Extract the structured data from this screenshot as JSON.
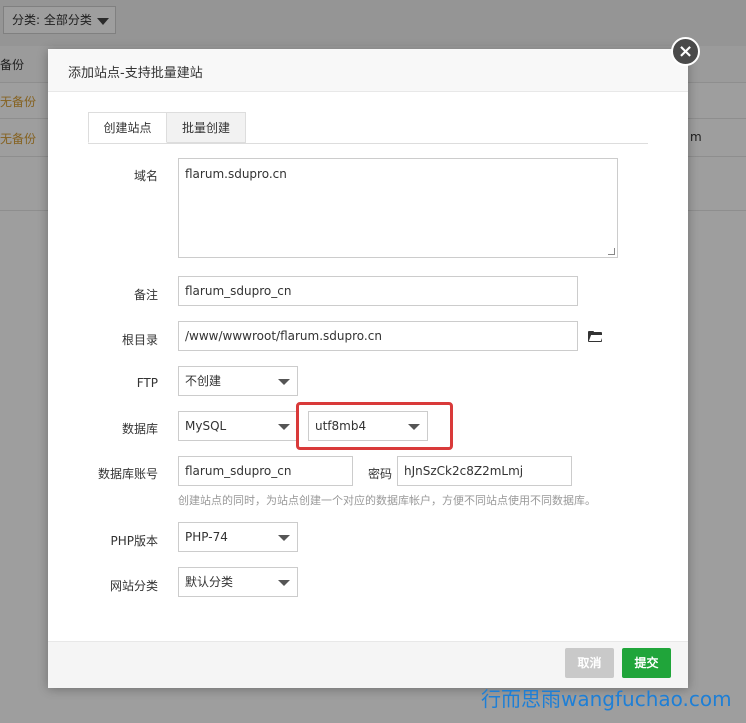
{
  "background": {
    "filter_label": "分类: 全部分类",
    "col_backup": "备份",
    "row1_backup": "无备份",
    "row2_backup": "无备份",
    "row2_tail": "m"
  },
  "dialog": {
    "title": "添加站点-支持批量建站",
    "close_symbol": "×",
    "tabs": [
      {
        "label": "创建站点",
        "active": true
      },
      {
        "label": "批量创建",
        "active": false
      }
    ],
    "fields": {
      "domain": {
        "label": "域名",
        "value": "flarum.sdupro.cn"
      },
      "remark": {
        "label": "备注",
        "value": "flarum_sdupro_cn"
      },
      "root": {
        "label": "根目录",
        "value": "/www/wwwroot/flarum.sdupro.cn"
      },
      "ftp": {
        "label": "FTP",
        "value": "不创建"
      },
      "database": {
        "label": "数据库",
        "type": "MySQL",
        "charset": "utf8mb4"
      },
      "db_account": {
        "label": "数据库账号",
        "value": "flarum_sdupro_cn",
        "password_label": "密码",
        "password": "hJnSzCk2c8Z2mLmj"
      },
      "db_hint": "创建站点的同时，为站点创建一个对应的数据库帐户，方便不同站点使用不同数据库。",
      "php": {
        "label": "PHP版本",
        "value": "PHP-74"
      },
      "category": {
        "label": "网站分类",
        "value": "默认分类"
      }
    },
    "buttons": {
      "cancel": "取消",
      "submit": "提交"
    }
  },
  "watermark": "行而思雨wangfuchao.com",
  "colors": {
    "highlight": "#d93a3a",
    "submit": "#20a53a",
    "warning": "#d79e34",
    "watermark": "#1e7fd6"
  },
  "icons": {
    "folder": "folder-open-icon",
    "close": "close-icon",
    "select_caret": "chevron-down-icon"
  }
}
